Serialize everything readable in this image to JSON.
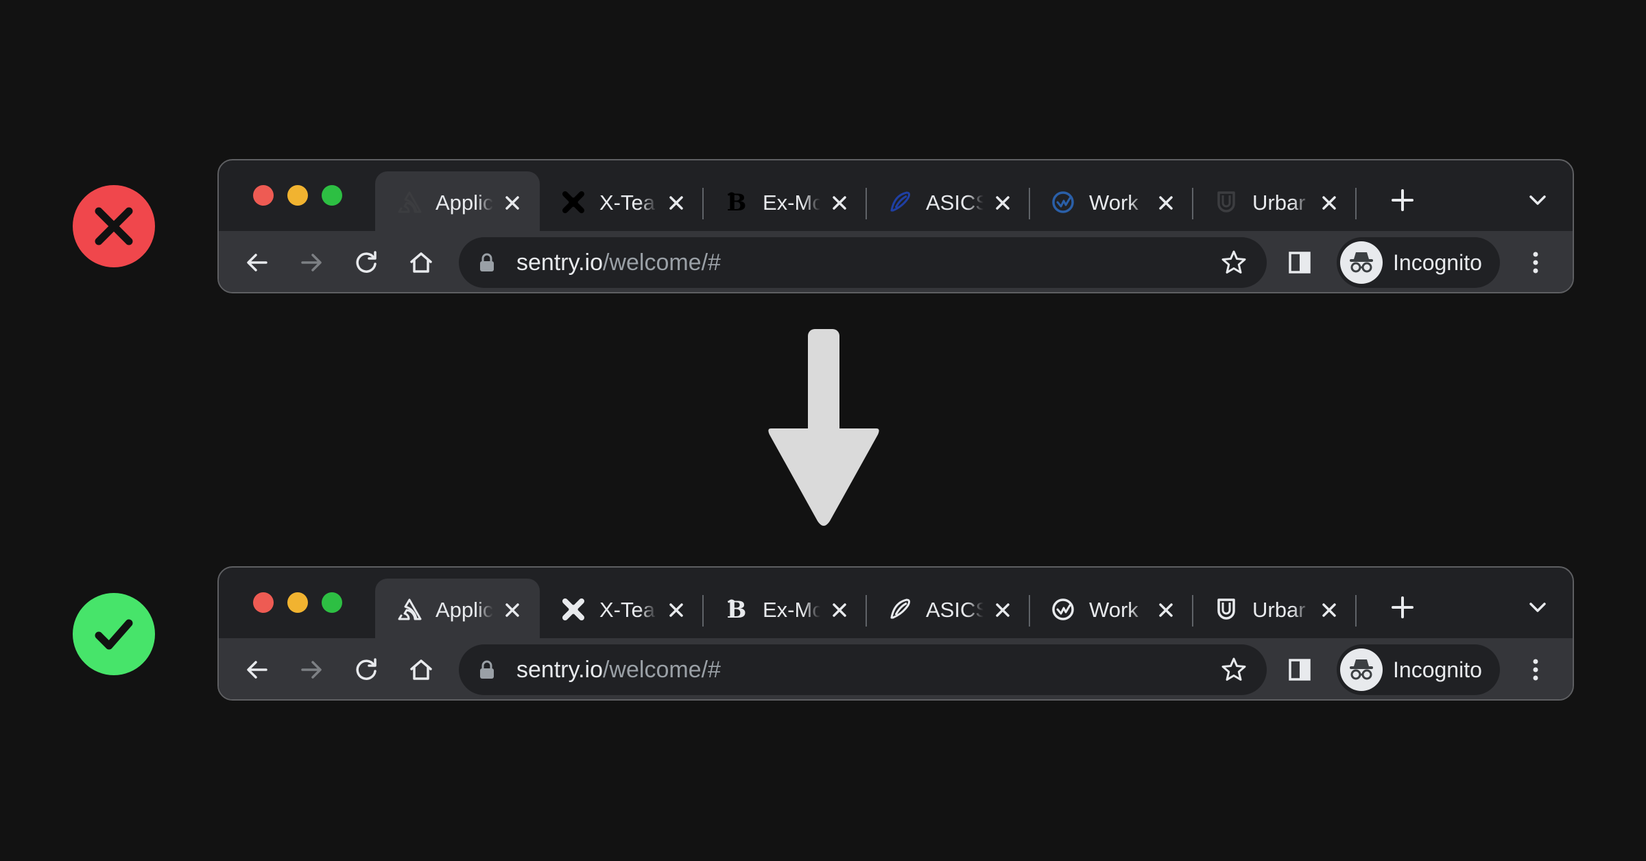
{
  "status_badges": {
    "before": {
      "icon": "x-mark-icon",
      "color": "#f0474c"
    },
    "after": {
      "icon": "checkmark-icon",
      "color": "#47e46a"
    }
  },
  "transition_arrow": {
    "icon": "arrow-down-icon",
    "color": "#dadada"
  },
  "browser_before": {
    "tabs": [
      {
        "title": "Applic",
        "favicon": "sentry-logo-icon",
        "favicon_color": "#3c3d40",
        "active": true
      },
      {
        "title": "X-Tea",
        "favicon": "x-team-logo-icon",
        "favicon_color": "#000000",
        "active": false
      },
      {
        "title": "Ex-Mc",
        "favicon": "blackletter-b-icon",
        "favicon_color": "#000000",
        "active": false
      },
      {
        "title": "ASICS",
        "favicon": "asics-logo-icon",
        "favicon_color": "#1f3fa3",
        "active": false
      },
      {
        "title": "Work",
        "favicon": "workflow-check-icon",
        "favicon_color": "#2a5fa8",
        "active": false
      },
      {
        "title": "Urbar",
        "favicon": "shield-u-icon",
        "favicon_color": "#3c3d40",
        "active": false
      }
    ],
    "url_host": "sentry.io",
    "url_path": "/welcome/#",
    "profile_label": "Incognito"
  },
  "browser_after": {
    "tabs": [
      {
        "title": "Applic",
        "favicon": "sentry-logo-icon",
        "favicon_color": "#e8eaed",
        "active": true
      },
      {
        "title": "X-Tea",
        "favicon": "x-team-logo-icon",
        "favicon_color": "#e8eaed",
        "active": false
      },
      {
        "title": "Ex-Mc",
        "favicon": "blackletter-b-icon",
        "favicon_color": "#e8eaed",
        "active": false
      },
      {
        "title": "ASICS",
        "favicon": "asics-logo-icon",
        "favicon_color": "#e8eaed",
        "active": false
      },
      {
        "title": "Work",
        "favicon": "workflow-check-icon",
        "favicon_color": "#e8eaed",
        "active": false
      },
      {
        "title": "Urbar",
        "favicon": "shield-u-icon",
        "favicon_color": "#e8eaed",
        "active": false
      }
    ],
    "url_host": "sentry.io",
    "url_path": "/welcome/#",
    "profile_label": "Incognito"
  },
  "colors": {
    "page_background": "#121212",
    "tabstrip": "#202124",
    "toolbar": "#35363a",
    "text": "#e8eaed",
    "muted_text": "#9aa0a6"
  }
}
